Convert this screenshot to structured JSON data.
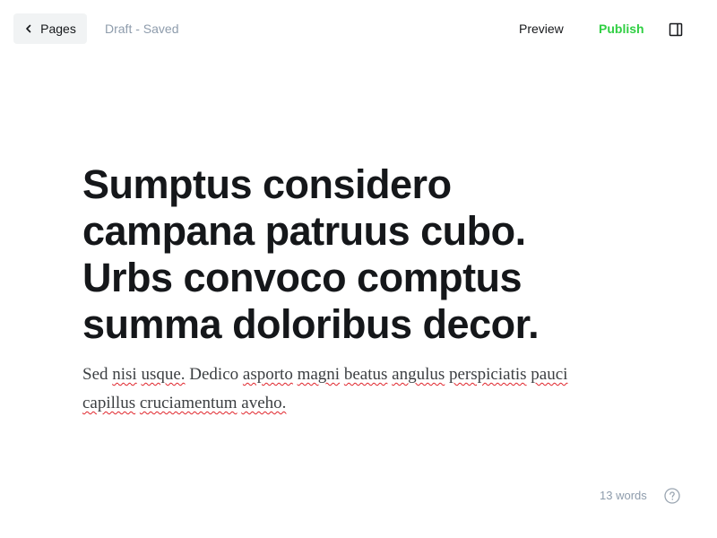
{
  "header": {
    "back_label": "Pages",
    "status": "Draft - Saved",
    "preview_label": "Preview",
    "publish_label": "Publish",
    "colors": {
      "publish": "#30cf43",
      "status": "#8e9cac",
      "back_bg": "#f1f3f4"
    },
    "icons": {
      "back": "chevron-left-icon",
      "sidebar": "sidebar-toggle-icon"
    }
  },
  "post": {
    "title": "Sumptus considero campana patruus cubo. Urbs convoco comptus summa doloribus decor.",
    "body_words": [
      "Sed",
      "nisi",
      "usque.",
      "Dedico",
      "asporto",
      "magni",
      "beatus",
      "angulus",
      "perspiciatis",
      "pauci",
      "capillus",
      "cruciamentum",
      "aveho."
    ],
    "misspelled_words": [
      "nisi",
      "usque.",
      "asporto",
      "magni",
      "beatus",
      "angulus",
      "perspiciatis",
      "pauci",
      "capillus",
      "cruciamentum",
      "aveho."
    ]
  },
  "footer": {
    "word_count": "13 words",
    "help_icon": "help-circle-icon"
  }
}
